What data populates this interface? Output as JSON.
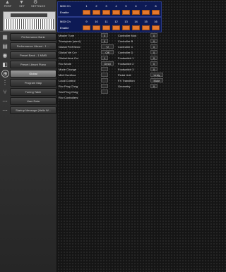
{
  "toolbar": {
    "items": [
      {
        "label": "PERF",
        "icon": "up-arrow-icon"
      },
      {
        "label": "SET",
        "icon": "down-arrow-icon"
      },
      {
        "label": "SETTINGS",
        "icon": "gear-icon"
      }
    ]
  },
  "sidebar": {
    "items": [
      {
        "label": "Performance Bank",
        "icon": "performance-bank-icon"
      },
      {
        "label": "Performance Librant - 1 ...",
        "icon": "performance-librant-icon"
      },
      {
        "label": "Preset Bank - 1 MMB",
        "icon": "preset-bank-icon"
      },
      {
        "label": "Preset Librant Piano",
        "icon": "preset-librant-icon"
      },
      {
        "label": "Global",
        "icon": "global-icon"
      },
      {
        "label": "Program Map",
        "icon": "program-map-icon"
      },
      {
        "label": "Tuning Table",
        "icon": "tuning-table-icon"
      },
      {
        "label": "User Data",
        "icon": "user-data-icon"
      },
      {
        "label": "Startup Message (Hello W...",
        "icon": "startup-message-icon"
      }
    ]
  },
  "midi_a": {
    "ch_label": "MIDI Ch",
    "enable_label": "Enable",
    "channels": [
      "1",
      "2",
      "3",
      "4",
      "5",
      "6",
      "7",
      "8"
    ]
  },
  "midi_b": {
    "ch_label": "MIDI Ch",
    "enable_label": "Enable",
    "channels": [
      "9",
      "10",
      "11",
      "12",
      "13",
      "14",
      "15",
      "16"
    ]
  },
  "params_left": [
    {
      "label": "Master Tune",
      "value": "0"
    },
    {
      "label": "Transpose (semi)",
      "value": "0"
    },
    {
      "label": "Global Perf Bend",
      "value": "+2"
    },
    {
      "label": "Global Vel Crv",
      "value": "Off"
    },
    {
      "label": "Global Ares Crv",
      "value": "1"
    },
    {
      "label": "Rcv Mode",
      "value": "Omni"
    },
    {
      "label": "Mode Change",
      "value": ""
    },
    {
      "label": "Midi Overflow",
      "value": ""
    },
    {
      "label": "Local Control",
      "value": ""
    },
    {
      "label": "Rcv Prog Chng",
      "value": ""
    },
    {
      "label": "Snd Prog Chng",
      "value": ""
    },
    {
      "label": "Rcv Controllers",
      "value": ""
    }
  ],
  "params_right": [
    {
      "label": "Controller Mod",
      "value": "0"
    },
    {
      "label": "Controller B",
      "value": "0"
    },
    {
      "label": "Controller C",
      "value": "0"
    },
    {
      "label": "Controller D",
      "value": "0"
    },
    {
      "label": "Footswitch 1",
      "value": "0"
    },
    {
      "label": "Footswitch 2",
      "value": "0"
    },
    {
      "label": "Footswitch 3",
      "value": "0"
    },
    {
      "label": "Pedal Unit",
      "value": "Unity"
    },
    {
      "label": "FX Transition",
      "value": "Mute"
    },
    {
      "label": "Geometry",
      "value": "0"
    }
  ]
}
